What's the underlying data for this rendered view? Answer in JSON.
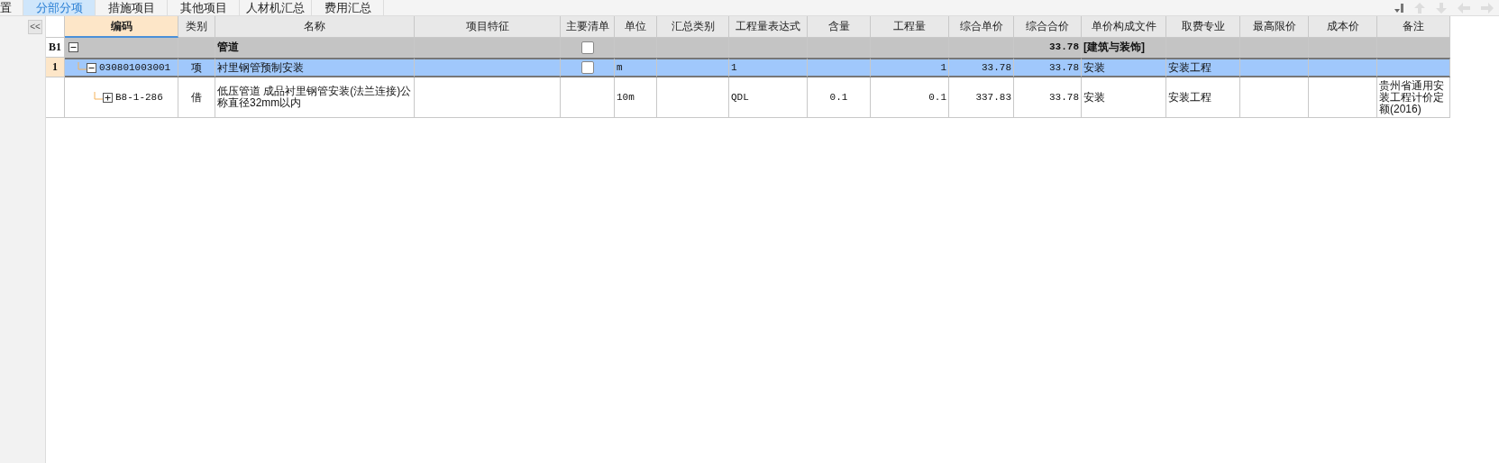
{
  "tabs": [
    {
      "label": "置",
      "selected": false
    },
    {
      "label": "分部分项",
      "selected": true
    },
    {
      "label": "措施项目",
      "selected": false
    },
    {
      "label": "其他项目",
      "selected": false
    },
    {
      "label": "人材机汇总",
      "selected": false
    },
    {
      "label": "费用汇总",
      "selected": false
    }
  ],
  "side_panel": {
    "collapse_button": "<<"
  },
  "table": {
    "columns": [
      {
        "label": "编码",
        "selected": true
      },
      {
        "label": "类别",
        "selected": false
      },
      {
        "label": "名称",
        "selected": false
      },
      {
        "label": "项目特征",
        "selected": false
      },
      {
        "label": "主要清单",
        "selected": false
      },
      {
        "label": "单位",
        "selected": false
      },
      {
        "label": "汇总类别",
        "selected": false
      },
      {
        "label": "工程量表达式",
        "selected": false
      },
      {
        "label": "含量",
        "selected": false
      },
      {
        "label": "工程量",
        "selected": false
      },
      {
        "label": "综合单价",
        "selected": false
      },
      {
        "label": "综合合价",
        "selected": false
      },
      {
        "label": "单价构成文件",
        "selected": false
      },
      {
        "label": "取费专业",
        "selected": false
      },
      {
        "label": "最高限价",
        "selected": false
      },
      {
        "label": "成本价",
        "selected": false
      },
      {
        "label": "备注",
        "selected": false
      }
    ],
    "rows": [
      {
        "kind": "group",
        "number": "B1",
        "expanded": true,
        "selected": false,
        "main_checked": false,
        "cells": {
          "name": "管道",
          "total_price": "33.78",
          "price_file": "[建筑与装饰]"
        },
        "children": [
          {
            "kind": "item",
            "number": "1",
            "expanded": true,
            "selected": true,
            "main_checked": false,
            "cells": {
              "code": "030801003001",
              "type": "项",
              "name": "衬里钢管预制安装",
              "unit": "m",
              "qty_expr": "1",
              "qty": "1",
              "unit_price": "33.78",
              "total_price": "33.78",
              "price_file": "安装",
              "fee_major": "安装工程"
            },
            "children": [
              {
                "kind": "sub",
                "expanded": false,
                "selected": false,
                "cells": {
                  "code": "B8-1-286",
                  "type": "借",
                  "name": "低压管道 成品衬里钢管安装(法兰连接)公称直径32mm以内",
                  "unit": "10m",
                  "qty_expr": "QDL",
                  "content": "0.1",
                  "qty": "0.1",
                  "unit_price": "337.83",
                  "total_price": "33.78",
                  "price_file": "安装",
                  "fee_major": "安装工程",
                  "remark": "贵州省通用安装工程计价定额(2016)"
                }
              }
            ]
          }
        ]
      }
    ]
  }
}
